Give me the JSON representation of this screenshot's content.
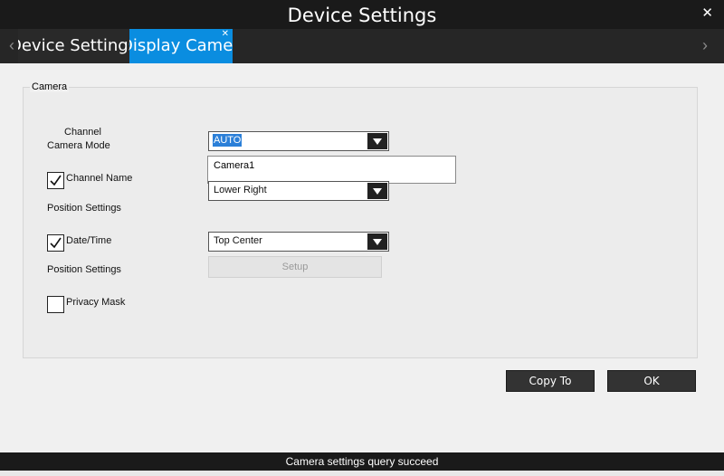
{
  "window": {
    "title": "Device Settings",
    "close_icon": "close-icon"
  },
  "tabs": [
    {
      "label": "Device Settings",
      "active": false
    },
    {
      "label": "Display Camera",
      "active": true
    }
  ],
  "camera_group": {
    "title": "Camera",
    "channel_label": "Channel",
    "camera_mode_label": "Camera Mode",
    "camera_mode_value": "AUTO",
    "channel_name_label": "Channel Name",
    "channel_name_checked": true,
    "channel_name_value": "Camera1",
    "channel_name_position_label": "Position Settings",
    "channel_name_position_value": "Lower Right",
    "datetime_label": "Date/Time",
    "datetime_checked": true,
    "datetime_position_label": "Position Settings",
    "datetime_position_value": "Top Center",
    "setup_label": "Setup",
    "privacy_mask_label": "Privacy Mask",
    "privacy_mask_checked": false
  },
  "buttons": {
    "copy_to": "Copy To",
    "ok": "OK"
  },
  "status": {
    "text": "Camera settings query succeed"
  },
  "colors": {
    "active_tab": "#0a8de0",
    "titlebar": "#1a1a1a",
    "selection": "#2b7fd8"
  }
}
